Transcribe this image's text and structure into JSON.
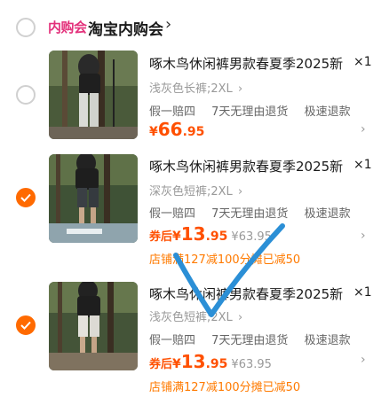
{
  "shop": {
    "badge": "内购会",
    "name": "淘宝内购会",
    "chevron": "›"
  },
  "items": [
    {
      "checked": false,
      "title": "啄木鸟休闲裤男款春夏季2025新",
      "qty": "×1",
      "sku": "浅灰色长裤;2XL",
      "sku_chevron": "›",
      "services": [
        "假一赔四",
        "7天无理由退货",
        "极速退款"
      ],
      "price_currency": "¥",
      "price_int": "66",
      "price_dec": ".95",
      "row_chevron": "›"
    },
    {
      "checked": true,
      "title": "啄木鸟休闲裤男款春夏季2025新",
      "qty": "×1",
      "sku": "深灰色短裤;2XL",
      "sku_chevron": "›",
      "services": [
        "假一赔四",
        "7天无理由退货",
        "极速退款"
      ],
      "coupon_label": "券后",
      "price_currency": "¥",
      "price_int": "13",
      "price_dec": ".95",
      "orig_price": "¥63.95",
      "promo": "店铺满127减100分摊已减50",
      "row_chevron": "›"
    },
    {
      "checked": true,
      "title": "啄木鸟休闲裤男款春夏季2025新",
      "qty": "×1",
      "sku": "浅灰色短裤;2XL",
      "sku_chevron": "›",
      "services": [
        "假一赔四",
        "7天无理由退货",
        "极速退款"
      ],
      "coupon_label": "券后",
      "price_currency": "¥",
      "price_int": "13",
      "price_dec": ".95",
      "orig_price": "¥63.95",
      "promo": "店铺满127减100分摊已减50",
      "row_chevron": "›"
    }
  ],
  "colors": {
    "accent": "#ff5000",
    "check": "#ff6a00",
    "badge": "#e3317b",
    "annotation": "#2b8fd6"
  }
}
